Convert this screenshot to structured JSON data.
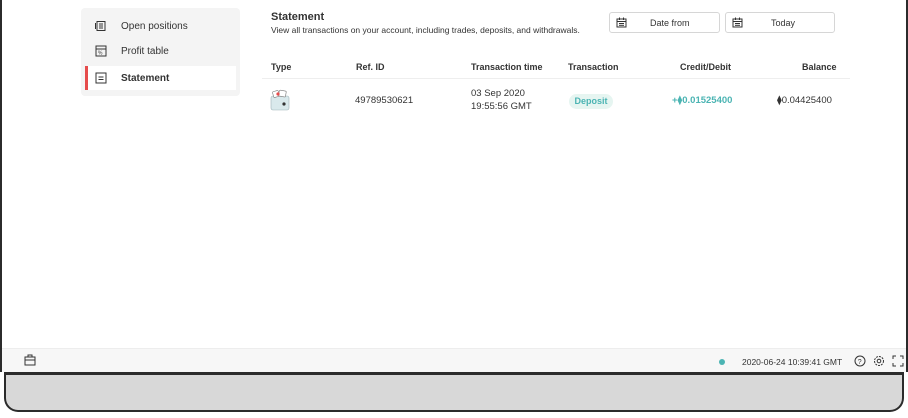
{
  "sidebar": {
    "items": [
      {
        "label": "Open positions",
        "icon": "open-positions-icon"
      },
      {
        "label": "Profit table",
        "icon": "profit-table-icon"
      },
      {
        "label": "Statement",
        "icon": "statement-icon",
        "active": true
      }
    ]
  },
  "statement": {
    "title": "Statement",
    "subtitle": "View all transactions on your account, including trades, deposits, and withdrawals.",
    "date_from": "Date from",
    "date_to": "Today"
  },
  "table": {
    "headers": [
      "Type",
      "Ref. ID",
      "Transaction time",
      "Transaction",
      "Credit/Debit",
      "Balance"
    ],
    "rows": [
      {
        "type_icon": "deposit-wallet-icon",
        "ref_id": "49789530621",
        "date": "03 Sep 2020",
        "time": "19:55:56 GMT",
        "transaction": "Deposit",
        "credit_debit": "+⧫0.01525400",
        "balance": "⧫0.04425400"
      }
    ]
  },
  "footer": {
    "status_dot_color": "#4bb4b3",
    "datetime": "2020-06-24 10:39:41 GMT",
    "icons": [
      "help-icon",
      "settings-icon",
      "fullscreen-icon"
    ],
    "left_icon": "account-switcher-icon"
  },
  "colors": {
    "accent": "#e64c4c",
    "positive": "#4bb4b3",
    "badge_bg": "#e6f5f1"
  }
}
